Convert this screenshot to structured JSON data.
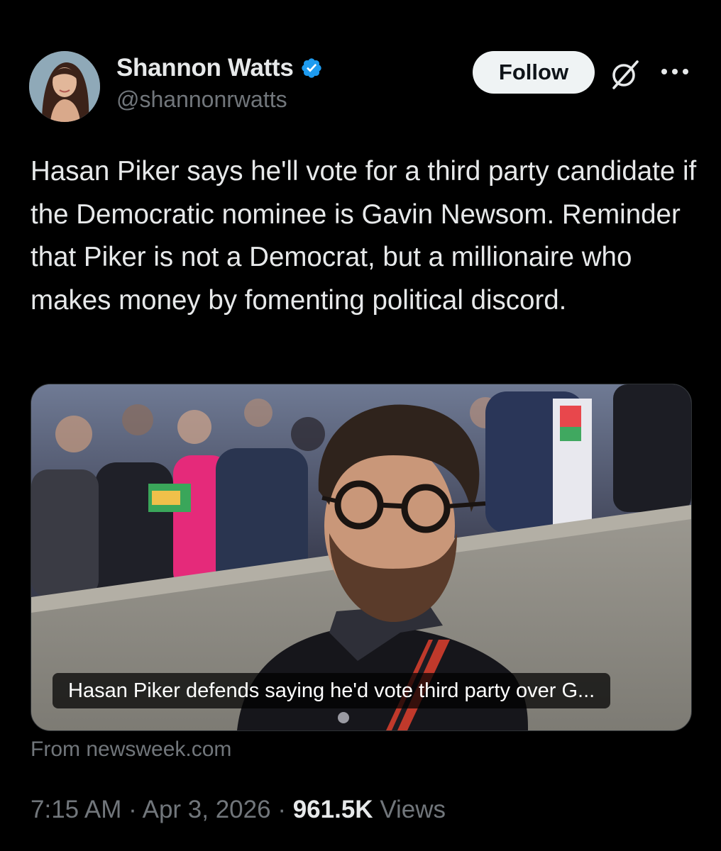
{
  "author": {
    "display_name": "Shannon Watts",
    "handle": "@shannonrwatts",
    "verified": true,
    "verified_color": "#1d9bf0"
  },
  "actions": {
    "follow_label": "Follow",
    "grok_icon": "grok-icon",
    "more_icon": "more-icon"
  },
  "tweet": {
    "text": "Hasan Piker says he'll vote for a third party candidate if the Democratic nominee is Gavin Newsom. Reminder that Piker is not a Democrat, but a millionaire who makes money by fomenting political discord."
  },
  "card": {
    "caption": "Hasan Piker defends saying he'd vote third party over G...",
    "source": "From newsweek.com"
  },
  "meta": {
    "time": "7:15 AM",
    "separator": "·",
    "date": "Apr 3, 2026",
    "views_count": "961.5K",
    "views_label": "Views"
  },
  "colors": {
    "background": "#000000",
    "text_primary": "#e7e9ea",
    "text_secondary": "#71767b",
    "button_bg": "#eff3f4"
  }
}
